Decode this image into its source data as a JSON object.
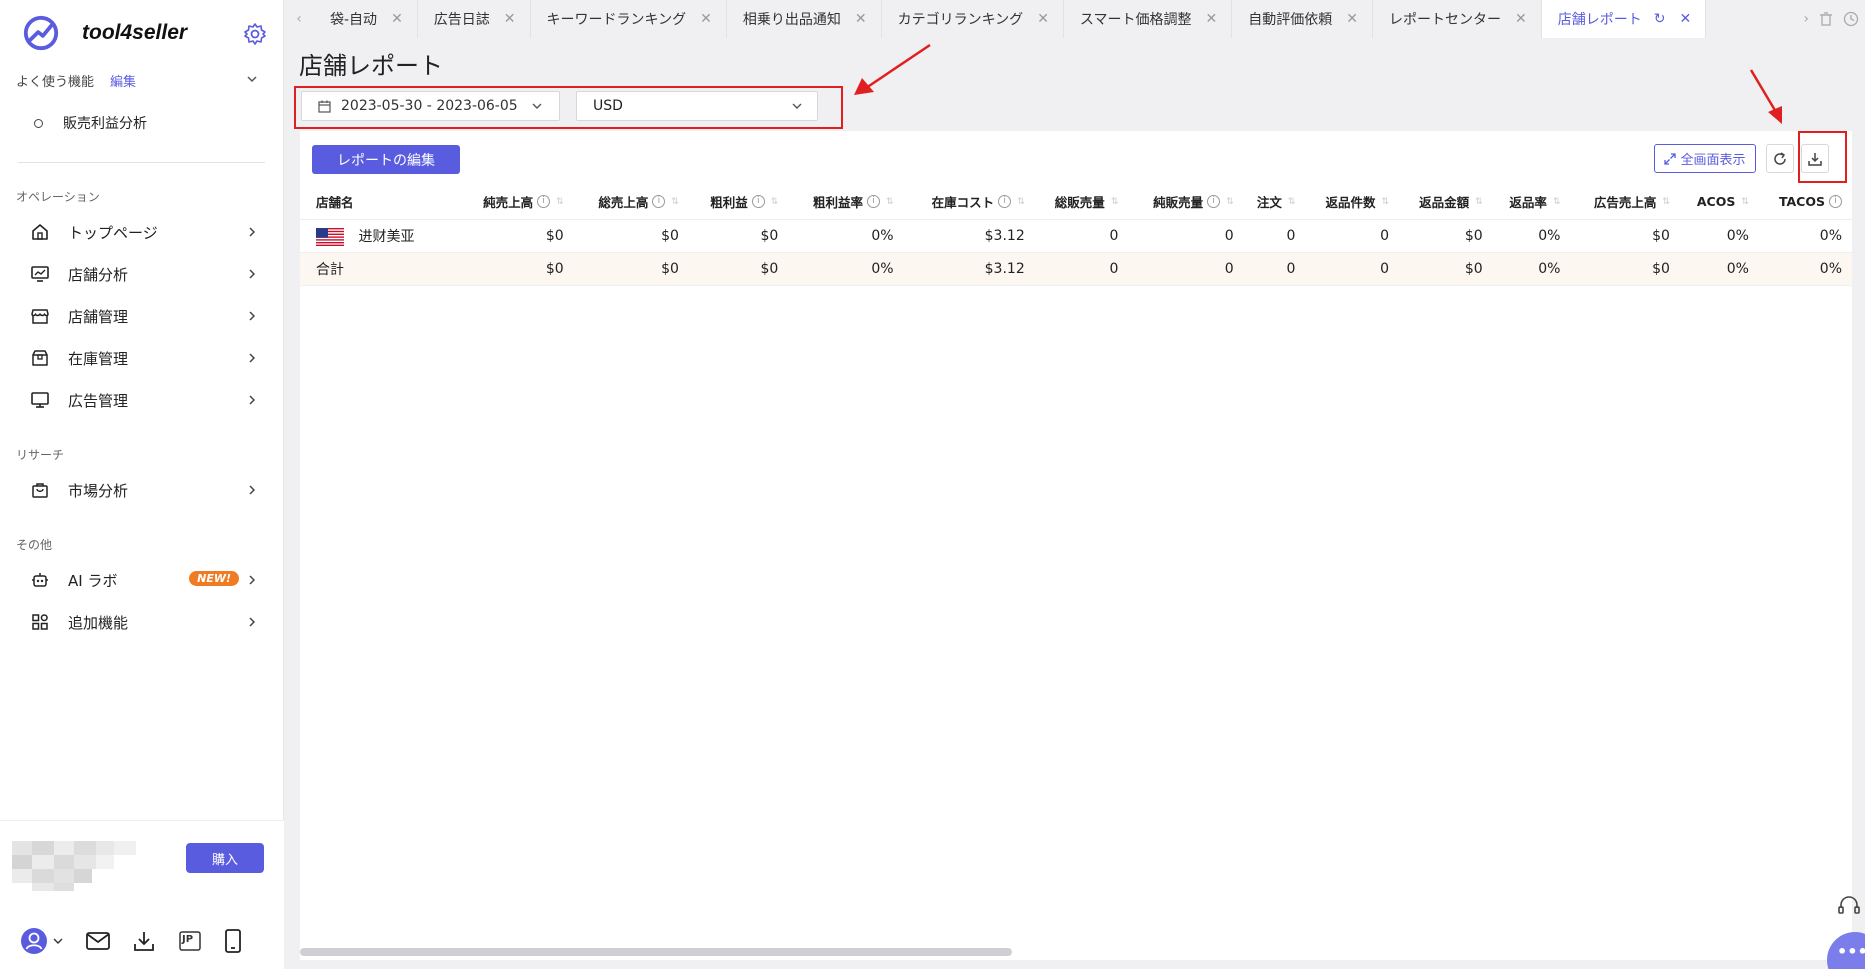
{
  "app": {
    "logo_text": "tool4seller"
  },
  "sidebar": {
    "favorites_label": "よく使う機能",
    "favorites_edit": "編集",
    "favorite_items": [
      "販売利益分析"
    ],
    "section_operations": "オペレーション",
    "operations_items": [
      {
        "label": "トップページ",
        "icon": "home-icon"
      },
      {
        "label": "店舗分析",
        "icon": "chart-monitor-icon"
      },
      {
        "label": "店舗管理",
        "icon": "store-icon"
      },
      {
        "label": "在庫管理",
        "icon": "box-icon"
      },
      {
        "label": "広告管理",
        "icon": "monitor-icon"
      }
    ],
    "section_research": "リサーチ",
    "research_items": [
      {
        "label": "市場分析",
        "icon": "bag-icon"
      }
    ],
    "section_other": "その他",
    "other_items": [
      {
        "label": "AI ラボ",
        "icon": "robot-icon",
        "badge": "NEW!"
      },
      {
        "label": "追加機能",
        "icon": "apps-icon"
      }
    ],
    "buy_label": "購入",
    "bottom_icons": [
      "user-avatar-icon",
      "mail-icon",
      "download-icon",
      "jp-region-icon",
      "mobile-icon"
    ],
    "region_text": "JP"
  },
  "tabs": [
    {
      "label": "袋-自动",
      "active": false
    },
    {
      "label": "広告日誌",
      "active": false
    },
    {
      "label": "キーワードランキング",
      "active": false
    },
    {
      "label": "相乗り出品通知",
      "active": false
    },
    {
      "label": "カテゴリランキング",
      "active": false
    },
    {
      "label": "スマート価格調整",
      "active": false
    },
    {
      "label": "自動評価依頼",
      "active": false
    },
    {
      "label": "レポートセンター",
      "active": false
    },
    {
      "label": "店舗レポート",
      "active": true
    }
  ],
  "page": {
    "title": "店舗レポート",
    "date_range": "2023-05-30 - 2023-06-05",
    "currency": "USD",
    "edit_report_label": "レポートの編集",
    "fullscreen_label": "全画面表示"
  },
  "table": {
    "columns": [
      "店舗名",
      "純売上高",
      "総売上高",
      "粗利益",
      "粗利益率",
      "在庫コスト",
      "総販売量",
      "純販売量",
      "注文",
      "返品件数",
      "返品金額",
      "返品率",
      "広告売上高",
      "ACOS",
      "TACOS"
    ],
    "rows": [
      {
        "flag": "us-flag",
        "cells": [
          "进财美亚",
          "$0",
          "$0",
          "$0",
          "0%",
          "$3.12",
          "0",
          "0",
          "0",
          "0",
          "$0",
          "0%",
          "$0",
          "0%",
          "0%"
        ]
      }
    ],
    "total": [
      "合計",
      "$0",
      "$0",
      "$0",
      "0%",
      "$3.12",
      "0",
      "0",
      "0",
      "0",
      "$0",
      "0%",
      "$0",
      "0%",
      "0%"
    ]
  },
  "colors": {
    "accent": "#5a5ce0",
    "annotation_red": "#e02020",
    "badge_orange": "#f07b23"
  }
}
